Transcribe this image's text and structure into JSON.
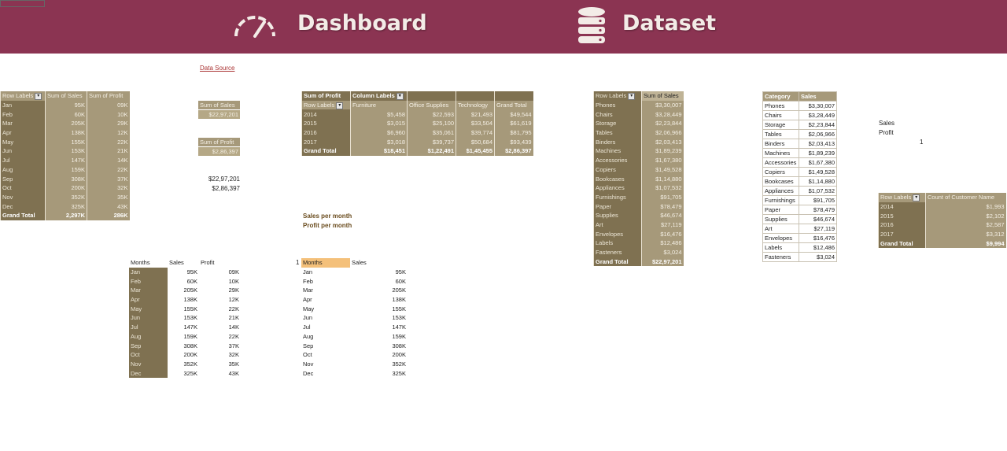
{
  "banner": {
    "dashboard_label": "Dashboard",
    "dataset_label": "Dataset",
    "color": "#8b3452"
  },
  "data_source_link": "Data Source",
  "monthly_pivot": {
    "headers": [
      "Row Labels",
      "Sum of Sales",
      "Sum of Profit"
    ],
    "rows": [
      [
        "Jan",
        "95K",
        "09K"
      ],
      [
        "Feb",
        "60K",
        "10K"
      ],
      [
        "Mar",
        "205K",
        "29K"
      ],
      [
        "Apr",
        "138K",
        "12K"
      ],
      [
        "May",
        "155K",
        "22K"
      ],
      [
        "Jun",
        "153K",
        "21K"
      ],
      [
        "Jul",
        "147K",
        "14K"
      ],
      [
        "Aug",
        "159K",
        "22K"
      ],
      [
        "Sep",
        "308K",
        "37K"
      ],
      [
        "Oct",
        "200K",
        "32K"
      ],
      [
        "Nov",
        "352K",
        "35K"
      ],
      [
        "Dec",
        "325K",
        "43K"
      ]
    ],
    "total": [
      "Grand Total",
      "2,297K",
      "286K"
    ]
  },
  "sum_sales_card": {
    "label": "Sum of Sales",
    "value": "$22,97,201"
  },
  "sum_profit_card": {
    "label": "Sum of Profit",
    "value": "$2,86,397"
  },
  "plain_values": {
    "sales": "$22,97,201",
    "profit": "$2,86,397"
  },
  "profit_pivot": {
    "header1": [
      "Sum of Profit",
      "Column Labels"
    ],
    "header2": [
      "Row Labels",
      "Furniture",
      "Office Supplies",
      "Technology",
      "Grand Total"
    ],
    "rows": [
      [
        "2014",
        "$5,458",
        "$22,593",
        "$21,493",
        "$49,544"
      ],
      [
        "2015",
        "$3,015",
        "$25,100",
        "$33,504",
        "$61,619"
      ],
      [
        "2016",
        "$6,960",
        "$35,061",
        "$39,774",
        "$81,795"
      ],
      [
        "2017",
        "$3,018",
        "$39,737",
        "$50,684",
        "$93,439"
      ]
    ],
    "total": [
      "Grand Total",
      "$18,451",
      "$1,22,491",
      "$1,45,455",
      "$2,86,397"
    ]
  },
  "sub_pivot": {
    "headers": [
      "Row Labels",
      "Sum of Sales"
    ],
    "rows": [
      [
        "Phones",
        "$3,30,007"
      ],
      [
        "Chairs",
        "$3,28,449"
      ],
      [
        "Storage",
        "$2,23,844"
      ],
      [
        "Tables",
        "$2,06,966"
      ],
      [
        "Binders",
        "$2,03,413"
      ],
      [
        "Machines",
        "$1,89,239"
      ],
      [
        "Accessories",
        "$1,67,380"
      ],
      [
        "Copiers",
        "$1,49,528"
      ],
      [
        "Bookcases",
        "$1,14,880"
      ],
      [
        "Appliances",
        "$1,07,532"
      ],
      [
        "Furnishings",
        "$91,705"
      ],
      [
        "Paper",
        "$78,479"
      ],
      [
        "Supplies",
        "$46,674"
      ],
      [
        "Art",
        "$27,119"
      ],
      [
        "Envelopes",
        "$16,476"
      ],
      [
        "Labels",
        "$12,486"
      ],
      [
        "Fasteners",
        "$3,024"
      ]
    ],
    "total": [
      "Grand Total",
      "$22,97,201"
    ]
  },
  "category_table": {
    "headers": [
      "Category",
      "Sales"
    ],
    "rows": [
      [
        "Phones",
        "$3,30,007"
      ],
      [
        "Chairs",
        "$3,28,449"
      ],
      [
        "Storage",
        "$2,23,844"
      ],
      [
        "Tables",
        "$2,06,966"
      ],
      [
        "Binders",
        "$2,03,413"
      ],
      [
        "Machines",
        "$1,89,239"
      ],
      [
        "Accessories",
        "$1,67,380"
      ],
      [
        "Copiers",
        "$1,49,528"
      ],
      [
        "Bookcases",
        "$1,14,880"
      ],
      [
        "Appliances",
        "$1,07,532"
      ],
      [
        "Furnishings",
        "$91,705"
      ],
      [
        "Paper",
        "$78,479"
      ],
      [
        "Supplies",
        "$46,674"
      ],
      [
        "Art",
        "$27,119"
      ],
      [
        "Envelopes",
        "$16,476"
      ],
      [
        "Labels",
        "$12,486"
      ],
      [
        "Fasteners",
        "$3,024"
      ]
    ]
  },
  "side_labels": {
    "sales": "Sales",
    "profit": "Profit",
    "one": "1"
  },
  "customer_pivot": {
    "headers": [
      "Row Labels",
      "Count of Customer Name"
    ],
    "rows": [
      [
        "2014",
        "$1,993"
      ],
      [
        "2015",
        "$2,102"
      ],
      [
        "2016",
        "$2,587"
      ],
      [
        "2017",
        "$3,312"
      ]
    ],
    "total": [
      "Grand Total",
      "$9,994"
    ]
  },
  "tags": {
    "sales_per_month": "Sales per month",
    "profit_per_month": "Profit per month"
  },
  "months_table": {
    "headers": [
      "Months",
      "Sales",
      "Profit"
    ],
    "rows": [
      [
        "Jan",
        "95K",
        "09K"
      ],
      [
        "Feb",
        "60K",
        "10K"
      ],
      [
        "Mar",
        "205K",
        "29K"
      ],
      [
        "Apr",
        "138K",
        "12K"
      ],
      [
        "May",
        "155K",
        "22K"
      ],
      [
        "Jun",
        "153K",
        "21K"
      ],
      [
        "Jul",
        "147K",
        "14K"
      ],
      [
        "Aug",
        "159K",
        "22K"
      ],
      [
        "Sep",
        "308K",
        "37K"
      ],
      [
        "Oct",
        "200K",
        "32K"
      ],
      [
        "Nov",
        "352K",
        "35K"
      ],
      [
        "Dec",
        "325K",
        "43K"
      ]
    ]
  },
  "months_sales_table": {
    "index": "1",
    "headers": [
      "Months",
      "Sales"
    ],
    "rows": [
      [
        "Jan",
        "95K"
      ],
      [
        "Feb",
        "60K"
      ],
      [
        "Mar",
        "205K"
      ],
      [
        "Apr",
        "138K"
      ],
      [
        "May",
        "155K"
      ],
      [
        "Jun",
        "153K"
      ],
      [
        "Jul",
        "147K"
      ],
      [
        "Aug",
        "159K"
      ],
      [
        "Sep",
        "308K"
      ],
      [
        "Oct",
        "200K"
      ],
      [
        "Nov",
        "352K"
      ],
      [
        "Dec",
        "325K"
      ]
    ]
  }
}
